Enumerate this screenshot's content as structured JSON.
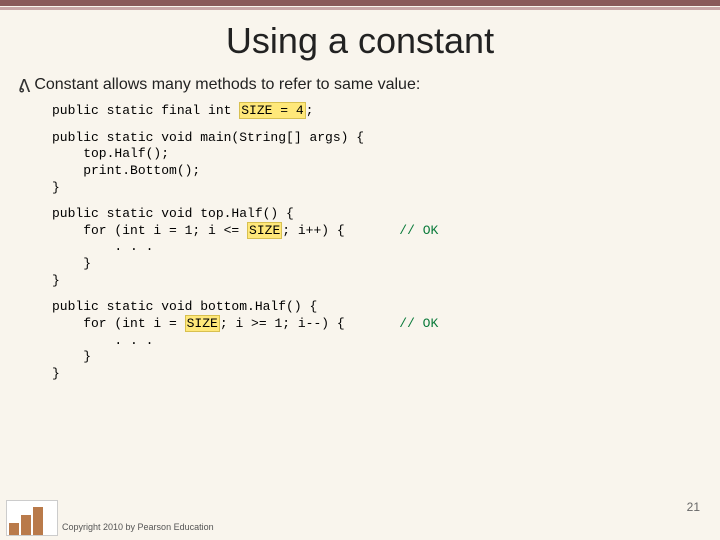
{
  "title": "Using a constant",
  "bullet": "Constant allows many methods to refer to same value:",
  "code": {
    "line1a": "public static final int ",
    "line1b": "SIZE = 4",
    "line1c": ";",
    "block2": "public static void main(String[] args) {\n    top.Half();\n    print.Bottom();\n}",
    "l3a": "public static void top.Half() {\n    for (int i = 1; i <= ",
    "l3b": "SIZE",
    "l3c": "; i++) {       ",
    "l3d": "// OK",
    "l3e": "\n        . . .\n    }\n}",
    "l4a": "public static void bottom.Half() {\n    for (int i = ",
    "l4b": "SIZE",
    "l4c": "; i >= 1; i--) {       ",
    "l4d": "// OK",
    "l4e": "\n        . . .\n    }\n}"
  },
  "page": "21",
  "copyright": "Copyright 2010 by Pearson Education"
}
